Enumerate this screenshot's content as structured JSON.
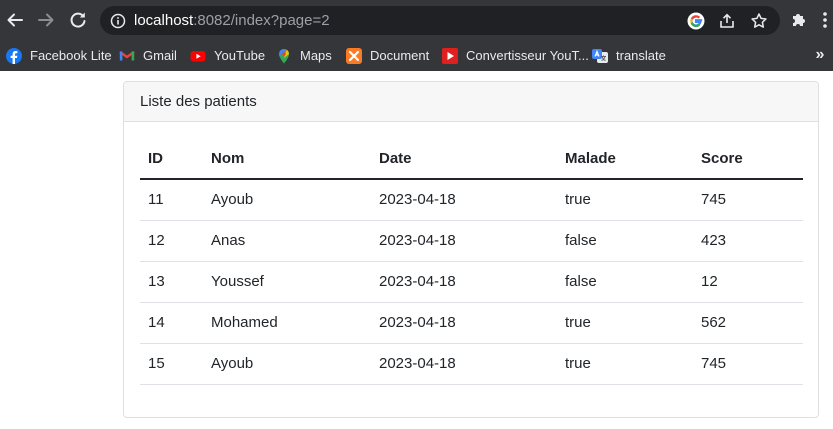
{
  "browser": {
    "url_host": "localhost",
    "url_rest": ":8082/index?page=2",
    "icons": {
      "back": "arrow-left-icon",
      "forward": "arrow-right-icon",
      "reload": "reload-icon",
      "info": "info-icon",
      "google": "google-icon",
      "share": "share-icon",
      "bookmark": "star-icon",
      "extensions": "puzzle-icon",
      "menu": "kebab-menu-icon"
    },
    "bookmarks": [
      {
        "label": "Facebook Lite",
        "icon": "facebook-icon",
        "color": "#1877f2"
      },
      {
        "label": "Gmail",
        "icon": "gmail-icon",
        "color": "#ea4335"
      },
      {
        "label": "YouTube",
        "icon": "youtube-icon",
        "color": "#ff0000"
      },
      {
        "label": "Maps",
        "icon": "maps-pin-icon",
        "color": "#34a853"
      },
      {
        "label": "Document",
        "icon": "xampp-icon",
        "color": "#fb7a24"
      },
      {
        "label": "Convertisseur YouT...",
        "icon": "youtube-converter-icon",
        "color": "#e02020"
      },
      {
        "label": "translate",
        "icon": "google-translate-icon",
        "color": "#4285f4"
      }
    ],
    "overflow_label": "»"
  },
  "card": {
    "title": "Liste des patients"
  },
  "table": {
    "headers": [
      "ID",
      "Nom",
      "Date",
      "Malade",
      "Score"
    ],
    "rows": [
      [
        "11",
        "Ayoub",
        "2023-04-18",
        "true",
        "745"
      ],
      [
        "12",
        "Anas",
        "2023-04-18",
        "false",
        "423"
      ],
      [
        "13",
        "Youssef",
        "2023-04-18",
        "false",
        "12"
      ],
      [
        "14",
        "Mohamed",
        "2023-04-18",
        "true",
        "562"
      ],
      [
        "15",
        "Ayoub",
        "2023-04-18",
        "true",
        "745"
      ]
    ]
  }
}
